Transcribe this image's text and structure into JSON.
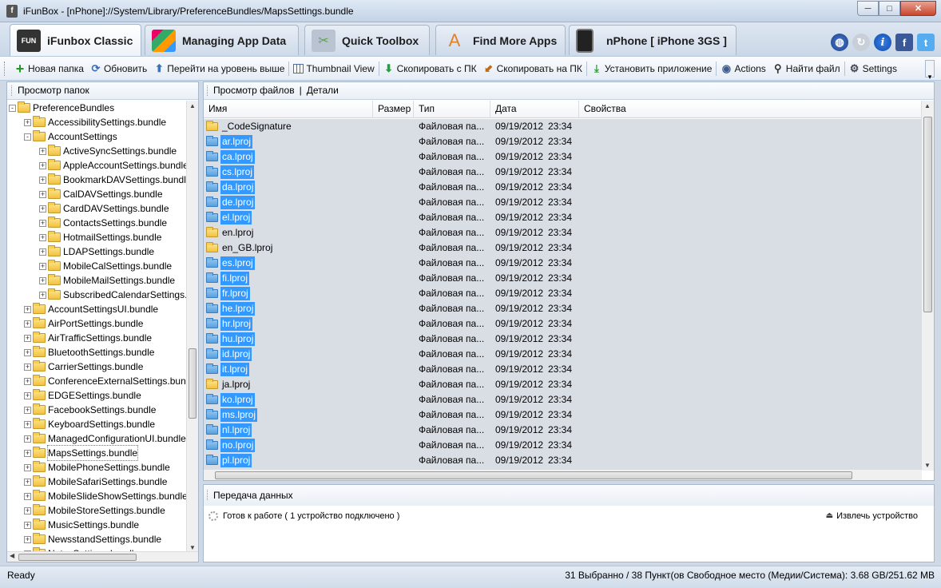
{
  "window": {
    "title": "iFunBox - [nPhone]://System/Library/PreferenceBundles/MapsSettings.bundle",
    "min": "─",
    "max": "□",
    "close": "✕"
  },
  "tabs": [
    {
      "label": "iFunbox Classic",
      "icon": "fun-icon"
    },
    {
      "label": "Managing App Data",
      "icon": "apps-grid-icon"
    },
    {
      "label": "Quick Toolbox",
      "icon": "toolbox-icon"
    },
    {
      "label": "Find More Apps",
      "icon": "app-store-icon"
    },
    {
      "label": "nPhone [ iPhone 3GS ]",
      "icon": "iphone-icon"
    }
  ],
  "header_icons": {
    "info": "i",
    "facebook": "f",
    "twitter": "t"
  },
  "toolbar": {
    "new_folder": "Новая папка",
    "refresh": "Обновить",
    "up_level": "Перейти на уровень выше",
    "thumbnail": "Thumbnail View",
    "copy_to_pc": "Скопировать с ПК",
    "copy_from_pc": "Скопировать на ПК",
    "install": "Установить приложение",
    "actions": "Actions",
    "find_file": "Найти файл",
    "settings": "Settings"
  },
  "left_panel": {
    "header": "Просмотр папок",
    "tree": [
      {
        "label": "PreferenceBundles",
        "level": 0,
        "exp": "-"
      },
      {
        "label": "AccessibilitySettings.bundle",
        "level": 1,
        "exp": "+"
      },
      {
        "label": "AccountSettings",
        "level": 1,
        "exp": "-"
      },
      {
        "label": "ActiveSyncSettings.bundle",
        "level": 2,
        "exp": "+"
      },
      {
        "label": "AppleAccountSettings.bundle",
        "level": 2,
        "exp": "+"
      },
      {
        "label": "BookmarkDAVSettings.bundle",
        "level": 2,
        "exp": "+"
      },
      {
        "label": "CalDAVSettings.bundle",
        "level": 2,
        "exp": "+"
      },
      {
        "label": "CardDAVSettings.bundle",
        "level": 2,
        "exp": "+"
      },
      {
        "label": "ContactsSettings.bundle",
        "level": 2,
        "exp": "+"
      },
      {
        "label": "HotmailSettings.bundle",
        "level": 2,
        "exp": "+"
      },
      {
        "label": "LDAPSettings.bundle",
        "level": 2,
        "exp": "+"
      },
      {
        "label": "MobileCalSettings.bundle",
        "level": 2,
        "exp": "+"
      },
      {
        "label": "MobileMailSettings.bundle",
        "level": 2,
        "exp": "+"
      },
      {
        "label": "SubscribedCalendarSettings.bundle",
        "level": 2,
        "exp": "+"
      },
      {
        "label": "AccountSettingsUI.bundle",
        "level": 1,
        "exp": "+"
      },
      {
        "label": "AirPortSettings.bundle",
        "level": 1,
        "exp": "+"
      },
      {
        "label": "AirTrafficSettings.bundle",
        "level": 1,
        "exp": "+"
      },
      {
        "label": "BluetoothSettings.bundle",
        "level": 1,
        "exp": "+"
      },
      {
        "label": "CarrierSettings.bundle",
        "level": 1,
        "exp": "+"
      },
      {
        "label": "ConferenceExternalSettings.bundle",
        "level": 1,
        "exp": "+"
      },
      {
        "label": "EDGESettings.bundle",
        "level": 1,
        "exp": "+"
      },
      {
        "label": "FacebookSettings.bundle",
        "level": 1,
        "exp": "+"
      },
      {
        "label": "KeyboardSettings.bundle",
        "level": 1,
        "exp": "+"
      },
      {
        "label": "ManagedConfigurationUI.bundle",
        "level": 1,
        "exp": "+"
      },
      {
        "label": "MapsSettings.bundle",
        "level": 1,
        "exp": "+",
        "selected": true
      },
      {
        "label": "MobilePhoneSettings.bundle",
        "level": 1,
        "exp": "+"
      },
      {
        "label": "MobileSafariSettings.bundle",
        "level": 1,
        "exp": "+"
      },
      {
        "label": "MobileSlideShowSettings.bundle",
        "level": 1,
        "exp": "+"
      },
      {
        "label": "MobileStoreSettings.bundle",
        "level": 1,
        "exp": "+"
      },
      {
        "label": "MusicSettings.bundle",
        "level": 1,
        "exp": "+"
      },
      {
        "label": "NewsstandSettings.bundle",
        "level": 1,
        "exp": "+"
      },
      {
        "label": "NotesSettings.bundle",
        "level": 1,
        "exp": "+"
      }
    ]
  },
  "right_panel": {
    "view_files": "Просмотр файлов",
    "sep": "|",
    "details": "Детали",
    "columns": {
      "name": "Имя",
      "size": "Размер",
      "type": "Тип",
      "date": "Дата",
      "props": "Свойства"
    },
    "files": [
      {
        "name": "_CodeSignature",
        "type": "Файловая па...",
        "date": "09/19/2012",
        "time": "23:34",
        "selected": false
      },
      {
        "name": "ar.lproj",
        "type": "Файловая па...",
        "date": "09/19/2012",
        "time": "23:34",
        "selected": true
      },
      {
        "name": "ca.lproj",
        "type": "Файловая па...",
        "date": "09/19/2012",
        "time": "23:34",
        "selected": true
      },
      {
        "name": "cs.lproj",
        "type": "Файловая па...",
        "date": "09/19/2012",
        "time": "23:34",
        "selected": true
      },
      {
        "name": "da.lproj",
        "type": "Файловая па...",
        "date": "09/19/2012",
        "time": "23:34",
        "selected": true
      },
      {
        "name": "de.lproj",
        "type": "Файловая па...",
        "date": "09/19/2012",
        "time": "23:34",
        "selected": true
      },
      {
        "name": "el.lproj",
        "type": "Файловая па...",
        "date": "09/19/2012",
        "time": "23:34",
        "selected": true
      },
      {
        "name": "en.lproj",
        "type": "Файловая па...",
        "date": "09/19/2012",
        "time": "23:34",
        "selected": false
      },
      {
        "name": "en_GB.lproj",
        "type": "Файловая па...",
        "date": "09/19/2012",
        "time": "23:34",
        "selected": false
      },
      {
        "name": "es.lproj",
        "type": "Файловая па...",
        "date": "09/19/2012",
        "time": "23:34",
        "selected": true
      },
      {
        "name": "fi.lproj",
        "type": "Файловая па...",
        "date": "09/19/2012",
        "time": "23:34",
        "selected": true
      },
      {
        "name": "fr.lproj",
        "type": "Файловая па...",
        "date": "09/19/2012",
        "time": "23:34",
        "selected": true
      },
      {
        "name": "he.lproj",
        "type": "Файловая па...",
        "date": "09/19/2012",
        "time": "23:34",
        "selected": true
      },
      {
        "name": "hr.lproj",
        "type": "Файловая па...",
        "date": "09/19/2012",
        "time": "23:34",
        "selected": true
      },
      {
        "name": "hu.lproj",
        "type": "Файловая па...",
        "date": "09/19/2012",
        "time": "23:34",
        "selected": true
      },
      {
        "name": "id.lproj",
        "type": "Файловая па...",
        "date": "09/19/2012",
        "time": "23:34",
        "selected": true
      },
      {
        "name": "it.lproj",
        "type": "Файловая па...",
        "date": "09/19/2012",
        "time": "23:34",
        "selected": true
      },
      {
        "name": "ja.lproj",
        "type": "Файловая па...",
        "date": "09/19/2012",
        "time": "23:34",
        "selected": false
      },
      {
        "name": "ko.lproj",
        "type": "Файловая па...",
        "date": "09/19/2012",
        "time": "23:34",
        "selected": true
      },
      {
        "name": "ms.lproj",
        "type": "Файловая па...",
        "date": "09/19/2012",
        "time": "23:34",
        "selected": true
      },
      {
        "name": "nl.lproj",
        "type": "Файловая па...",
        "date": "09/19/2012",
        "time": "23:34",
        "selected": true
      },
      {
        "name": "no.lproj",
        "type": "Файловая па...",
        "date": "09/19/2012",
        "time": "23:34",
        "selected": true
      },
      {
        "name": "pl.lproj",
        "type": "Файловая па...",
        "date": "09/19/2012",
        "time": "23:34",
        "selected": true
      }
    ]
  },
  "transfer": {
    "header": "Передача данных",
    "ready": "Готов к работе ( 1 устройство подключено )",
    "eject": "Извлечь устройство"
  },
  "status": {
    "left": "Ready",
    "right": "31 Выбранно / 38 Пункт(ов  Свободное место (Медии/Система): 3.68 GB/251.62 MB"
  }
}
